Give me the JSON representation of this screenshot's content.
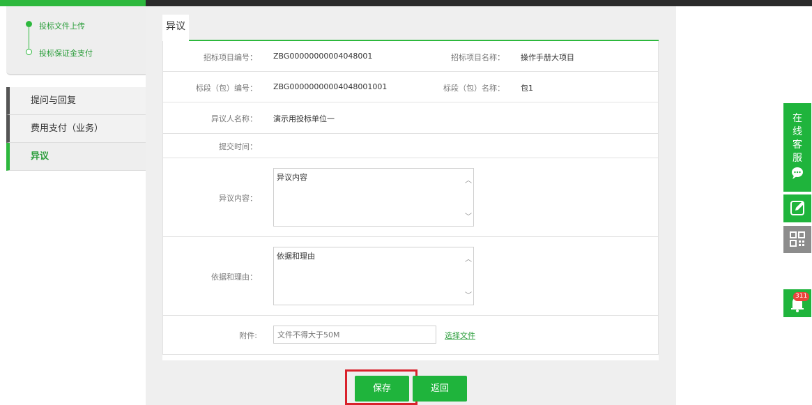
{
  "steps": [
    "投标文件上传",
    "投标保证金支付"
  ],
  "menu": {
    "items": [
      {
        "label": "提问与回复"
      },
      {
        "label": "费用支付（业务）"
      },
      {
        "label": "异议"
      }
    ]
  },
  "tab": {
    "label": "异议"
  },
  "form": {
    "project_no_label": "招标项目编号：",
    "project_no": "ZBG00000000004048001",
    "project_name_label": "招标项目名称：",
    "project_name": "操作手册大项目",
    "section_no_label": "标段（包）编号：",
    "section_no": "ZBG00000000004048001001",
    "section_name_label": "标段（包）名称：",
    "section_name": "包1",
    "objector_label": "异议人名称：",
    "objector": "演示用投标单位一",
    "submit_time_label": "提交时间：",
    "content_label": "异议内容：",
    "content_value": "异议内容",
    "reason_label": "依据和理由：",
    "reason_value": "依据和理由",
    "attachment_label": "附件:",
    "attachment_placeholder": "文件不得大于50M",
    "choose_file": "选择文件"
  },
  "buttons": {
    "save": "保存",
    "back": "返回"
  },
  "float": {
    "service": [
      "在",
      "线",
      "客",
      "服"
    ],
    "badge": "311"
  },
  "colors": {
    "accent": "#1fb43c",
    "highlight": "#d9212b"
  }
}
